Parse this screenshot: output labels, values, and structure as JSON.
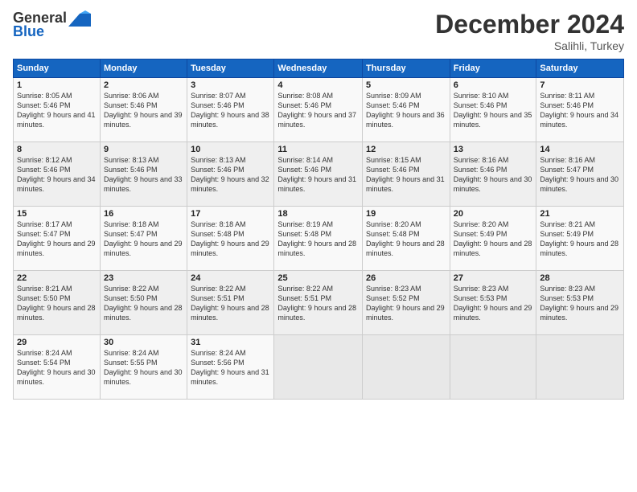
{
  "logo": {
    "general": "General",
    "blue": "Blue"
  },
  "header": {
    "month": "December 2024",
    "location": "Salihli, Turkey"
  },
  "days_of_week": [
    "Sunday",
    "Monday",
    "Tuesday",
    "Wednesday",
    "Thursday",
    "Friday",
    "Saturday"
  ],
  "weeks": [
    [
      {
        "day": "1",
        "sunrise": "8:05 AM",
        "sunset": "5:46 PM",
        "daylight": "9 hours and 41 minutes."
      },
      {
        "day": "2",
        "sunrise": "8:06 AM",
        "sunset": "5:46 PM",
        "daylight": "9 hours and 39 minutes."
      },
      {
        "day": "3",
        "sunrise": "8:07 AM",
        "sunset": "5:46 PM",
        "daylight": "9 hours and 38 minutes."
      },
      {
        "day": "4",
        "sunrise": "8:08 AM",
        "sunset": "5:46 PM",
        "daylight": "9 hours and 37 minutes."
      },
      {
        "day": "5",
        "sunrise": "8:09 AM",
        "sunset": "5:46 PM",
        "daylight": "9 hours and 36 minutes."
      },
      {
        "day": "6",
        "sunrise": "8:10 AM",
        "sunset": "5:46 PM",
        "daylight": "9 hours and 35 minutes."
      },
      {
        "day": "7",
        "sunrise": "8:11 AM",
        "sunset": "5:46 PM",
        "daylight": "9 hours and 34 minutes."
      }
    ],
    [
      {
        "day": "8",
        "sunrise": "8:12 AM",
        "sunset": "5:46 PM",
        "daylight": "9 hours and 34 minutes."
      },
      {
        "day": "9",
        "sunrise": "8:13 AM",
        "sunset": "5:46 PM",
        "daylight": "9 hours and 33 minutes."
      },
      {
        "day": "10",
        "sunrise": "8:13 AM",
        "sunset": "5:46 PM",
        "daylight": "9 hours and 32 minutes."
      },
      {
        "day": "11",
        "sunrise": "8:14 AM",
        "sunset": "5:46 PM",
        "daylight": "9 hours and 31 minutes."
      },
      {
        "day": "12",
        "sunrise": "8:15 AM",
        "sunset": "5:46 PM",
        "daylight": "9 hours and 31 minutes."
      },
      {
        "day": "13",
        "sunrise": "8:16 AM",
        "sunset": "5:46 PM",
        "daylight": "9 hours and 30 minutes."
      },
      {
        "day": "14",
        "sunrise": "8:16 AM",
        "sunset": "5:47 PM",
        "daylight": "9 hours and 30 minutes."
      }
    ],
    [
      {
        "day": "15",
        "sunrise": "8:17 AM",
        "sunset": "5:47 PM",
        "daylight": "9 hours and 29 minutes."
      },
      {
        "day": "16",
        "sunrise": "8:18 AM",
        "sunset": "5:47 PM",
        "daylight": "9 hours and 29 minutes."
      },
      {
        "day": "17",
        "sunrise": "8:18 AM",
        "sunset": "5:48 PM",
        "daylight": "9 hours and 29 minutes."
      },
      {
        "day": "18",
        "sunrise": "8:19 AM",
        "sunset": "5:48 PM",
        "daylight": "9 hours and 28 minutes."
      },
      {
        "day": "19",
        "sunrise": "8:20 AM",
        "sunset": "5:48 PM",
        "daylight": "9 hours and 28 minutes."
      },
      {
        "day": "20",
        "sunrise": "8:20 AM",
        "sunset": "5:49 PM",
        "daylight": "9 hours and 28 minutes."
      },
      {
        "day": "21",
        "sunrise": "8:21 AM",
        "sunset": "5:49 PM",
        "daylight": "9 hours and 28 minutes."
      }
    ],
    [
      {
        "day": "22",
        "sunrise": "8:21 AM",
        "sunset": "5:50 PM",
        "daylight": "9 hours and 28 minutes."
      },
      {
        "day": "23",
        "sunrise": "8:22 AM",
        "sunset": "5:50 PM",
        "daylight": "9 hours and 28 minutes."
      },
      {
        "day": "24",
        "sunrise": "8:22 AM",
        "sunset": "5:51 PM",
        "daylight": "9 hours and 28 minutes."
      },
      {
        "day": "25",
        "sunrise": "8:22 AM",
        "sunset": "5:51 PM",
        "daylight": "9 hours and 28 minutes."
      },
      {
        "day": "26",
        "sunrise": "8:23 AM",
        "sunset": "5:52 PM",
        "daylight": "9 hours and 29 minutes."
      },
      {
        "day": "27",
        "sunrise": "8:23 AM",
        "sunset": "5:53 PM",
        "daylight": "9 hours and 29 minutes."
      },
      {
        "day": "28",
        "sunrise": "8:23 AM",
        "sunset": "5:53 PM",
        "daylight": "9 hours and 29 minutes."
      }
    ],
    [
      {
        "day": "29",
        "sunrise": "8:24 AM",
        "sunset": "5:54 PM",
        "daylight": "9 hours and 30 minutes."
      },
      {
        "day": "30",
        "sunrise": "8:24 AM",
        "sunset": "5:55 PM",
        "daylight": "9 hours and 30 minutes."
      },
      {
        "day": "31",
        "sunrise": "8:24 AM",
        "sunset": "5:56 PM",
        "daylight": "9 hours and 31 minutes."
      },
      null,
      null,
      null,
      null
    ]
  ]
}
